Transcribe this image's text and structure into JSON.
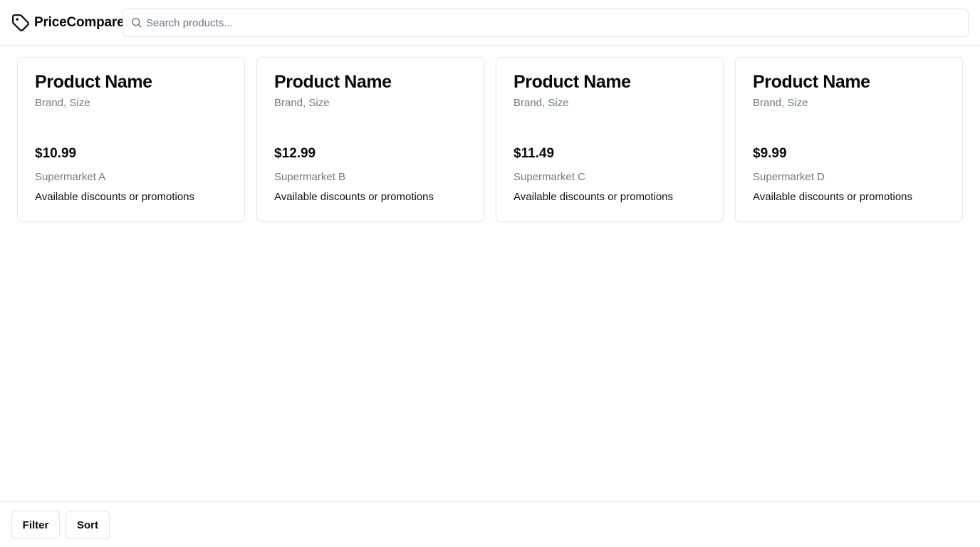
{
  "header": {
    "brand": "PriceCompare",
    "logo_icon": "tag-icon",
    "search": {
      "placeholder": "Search products...",
      "value": "",
      "icon": "search-icon"
    }
  },
  "products": [
    {
      "name": "Product Name",
      "subtitle": "Brand, Size",
      "price": "$10.99",
      "store": "Supermarket A",
      "promo": "Available discounts or promotions"
    },
    {
      "name": "Product Name",
      "subtitle": "Brand, Size",
      "price": "$12.99",
      "store": "Supermarket B",
      "promo": "Available discounts or promotions"
    },
    {
      "name": "Product Name",
      "subtitle": "Brand, Size",
      "price": "$11.49",
      "store": "Supermarket C",
      "promo": "Available discounts or promotions"
    },
    {
      "name": "Product Name",
      "subtitle": "Brand, Size",
      "price": "$9.99",
      "store": "Supermarket D",
      "promo": "Available discounts or promotions"
    }
  ],
  "footer": {
    "filter_label": "Filter",
    "sort_label": "Sort"
  },
  "colors": {
    "text": "#0a0a0a",
    "muted": "#737780",
    "border": "#e5e7eb",
    "background": "#ffffff"
  }
}
